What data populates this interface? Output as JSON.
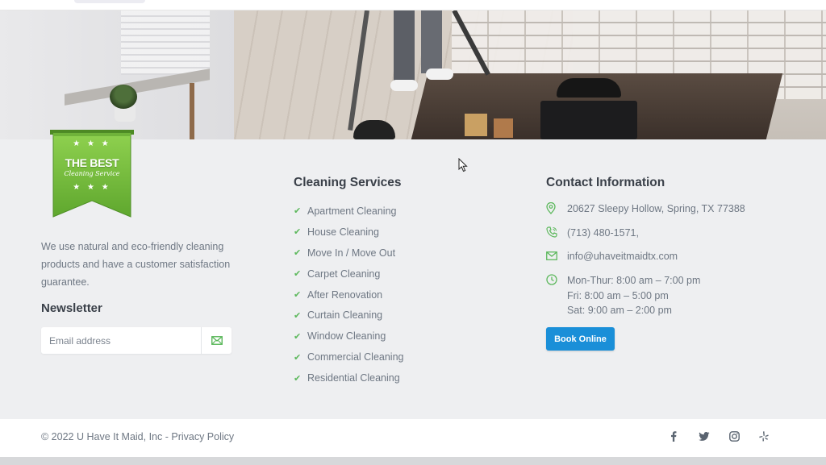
{
  "badge": {
    "title": "THE BEST",
    "subtitle": "Cleaning Service",
    "stars_top": "★ ★ ★",
    "stars_bottom": "★ ★ ★",
    "color": "#7cc243"
  },
  "about": {
    "text": "We use natural and eco-friendly cleaning products and have a customer satisfaction guarantee."
  },
  "newsletter": {
    "title": "Newsletter",
    "placeholder": "Email address",
    "submit_icon": "envelope-icon"
  },
  "services": {
    "title": "Cleaning Services",
    "items": [
      "Apartment Cleaning",
      "House Cleaning",
      "Move In / Move Out",
      "Carpet Cleaning",
      "After Renovation",
      "Curtain Cleaning",
      "Window Cleaning",
      "Commercial Cleaning",
      "Residential Cleaning"
    ]
  },
  "contact": {
    "title": "Contact Information",
    "address": "20627 Sleepy Hollow, Spring, TX 77388",
    "phone": "(713) 480-1571,",
    "email": "info@uhaveitmaidtx.com",
    "hours": [
      "Mon-Thur: 8:00 am – 7:00 pm",
      "Fri: 8:00 am – 5:00 pm",
      "Sat: 9:00 am – 2:00 pm"
    ],
    "book_label": "Book Online",
    "accent": "#1a8fd8",
    "icon_color": "#5cb85c"
  },
  "footer": {
    "copyright": "© 2022 U Have It Maid, Inc - ",
    "privacy_label": "Privacy Policy",
    "social": [
      "facebook-icon",
      "twitter-icon",
      "instagram-icon",
      "yelp-icon"
    ]
  }
}
